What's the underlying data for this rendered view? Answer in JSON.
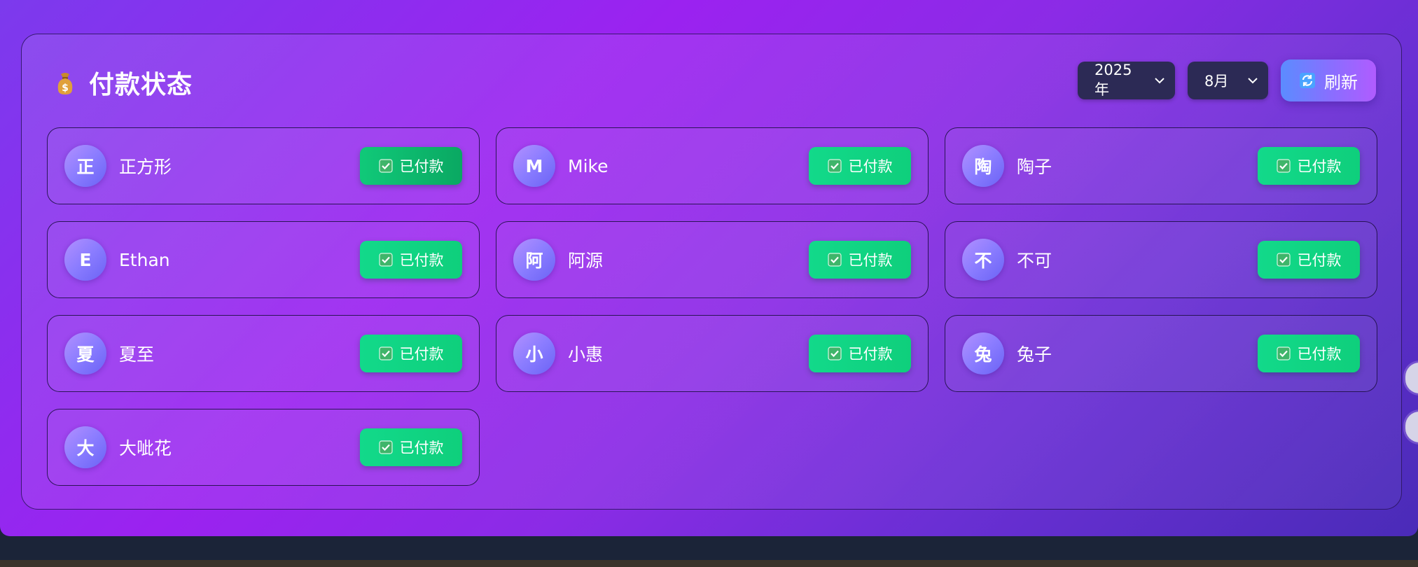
{
  "header": {
    "icon": "money-bag-icon",
    "title": "付款状态"
  },
  "filters": {
    "year": "2025年",
    "month": "8月",
    "refresh_label": "刷新",
    "refresh_icon": "refresh-icon"
  },
  "members": [
    {
      "initial": "正",
      "name": "正方形",
      "status": "已付款"
    },
    {
      "initial": "M",
      "name": "Mike",
      "status": "已付款"
    },
    {
      "initial": "陶",
      "name": "陶子",
      "status": "已付款"
    },
    {
      "initial": "E",
      "name": "Ethan",
      "status": "已付款"
    },
    {
      "initial": "阿",
      "name": "阿源",
      "status": "已付款"
    },
    {
      "initial": "不",
      "name": "不可",
      "status": "已付款"
    },
    {
      "initial": "夏",
      "name": "夏至",
      "status": "已付款"
    },
    {
      "initial": "小",
      "name": "小惠",
      "status": "已付款"
    },
    {
      "initial": "兔",
      "name": "兔子",
      "status": "已付款"
    },
    {
      "initial": "大",
      "name": "大呲花",
      "status": "已付款"
    }
  ],
  "colors": {
    "paid_green": "#12d98a",
    "select_bg": "#2c2a55",
    "accent_purple": "#9b22f0"
  }
}
